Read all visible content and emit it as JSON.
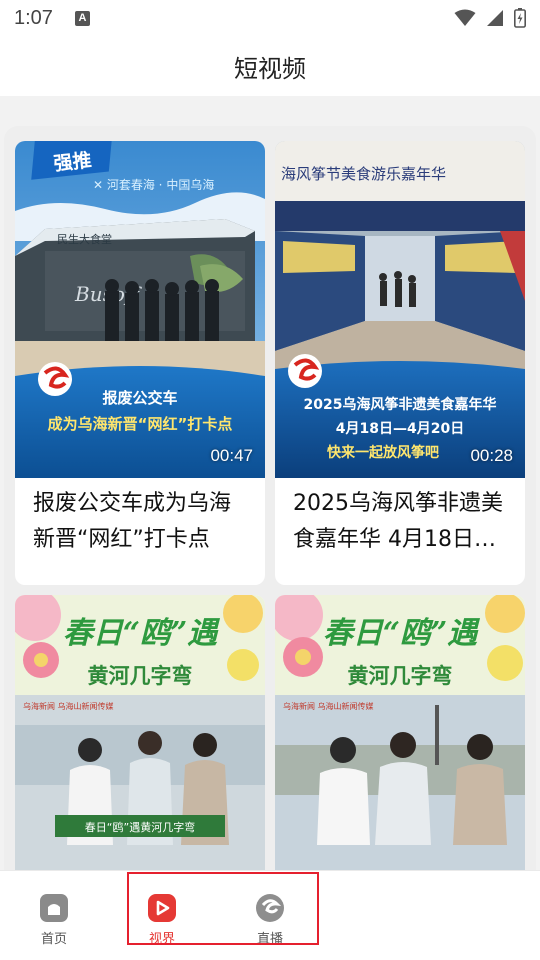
{
  "status_bar": {
    "time": "1:07",
    "notification_letter": "A"
  },
  "header": {
    "title": "短视频"
  },
  "videos": [
    {
      "badge": "强推",
      "tagline": "✕ 河套春海 · 中国乌海",
      "building_sign": "民生大食堂",
      "bus_text": "Busoff",
      "caption_line1": "报废公交车",
      "caption_line2": "成为乌海新晋“网红”打卡点",
      "duration": "00:47",
      "title": "报废公交车成为乌海新晋“网红”打卡点"
    },
    {
      "banner": "海风筝节美食游乐嘉年华",
      "caption_line1": "2025乌海风筝非遗美食嘉年华",
      "caption_line2": "4月18日—4月20日",
      "caption_line3": "快来一起放风筝吧",
      "duration": "00:28",
      "title": "2025乌海风筝非遗美食嘉年华 4月18日…"
    },
    {
      "headline": "春日“鸥”遇",
      "subheadline": "黄河几字弯",
      "logos": "乌海新闻  乌海山新闻传媒",
      "lower_caption": "春日“鸥”遇黄河几字弯"
    },
    {
      "headline": "春日“鸥”遇",
      "subheadline": "黄河几字弯",
      "logos": "乌海新闻  乌海山新闻传媒"
    }
  ],
  "bottom_nav": [
    {
      "label": "首页",
      "icon": "home-icon",
      "active": false
    },
    {
      "label": "视界",
      "icon": "video-play-icon",
      "active": true
    },
    {
      "label": "直播",
      "icon": "live-logo-icon",
      "active": false
    }
  ],
  "colors": {
    "accent": "#e53935",
    "highlight_border": "#e5202e",
    "page_bg": "#f2f2f2"
  }
}
